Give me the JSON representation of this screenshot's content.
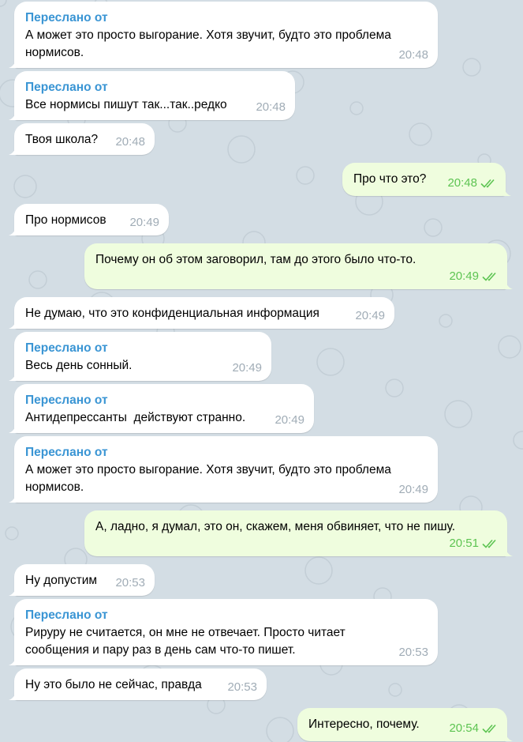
{
  "colors": {
    "background": "#d3dde4",
    "incoming_bubble": "#ffffff",
    "outgoing_bubble": "#effdde",
    "forward_label": "#3a95d4",
    "time_incoming": "#a0acb6",
    "time_outgoing": "#5dc452"
  },
  "messages": [
    {
      "dir": "in",
      "forwarded": "Переслано от",
      "lines": [
        "А может это просто выгорание. Хотя звучит, будто это проблема",
        "нормисов."
      ],
      "time": "20:48"
    },
    {
      "dir": "in",
      "forwarded": "Переслано от",
      "lines": [
        "Все нормисы пишут так...так..редко"
      ],
      "time": "20:48"
    },
    {
      "dir": "in",
      "lines": [
        "Твоя школа?"
      ],
      "time": "20:48"
    },
    {
      "dir": "out",
      "lines": [
        "Про что это?"
      ],
      "time": "20:48",
      "status_icon": "double-check-icon"
    },
    {
      "dir": "in",
      "lines": [
        "Про нормисов"
      ],
      "time": "20:49"
    },
    {
      "dir": "out",
      "lines": [
        "Почему он об этом заговорил, там до этого было что-то."
      ],
      "time": "20:49",
      "status_icon": "double-check-icon"
    },
    {
      "dir": "in",
      "lines": [
        "Не думаю, что это конфиденциальная информация"
      ],
      "time": "20:49"
    },
    {
      "dir": "in",
      "forwarded": "Переслано от",
      "lines": [
        "Весь день сонный."
      ],
      "time": "20:49"
    },
    {
      "dir": "in",
      "forwarded": "Переслано от",
      "lines": [
        "Антидепрессанты  действуют странно."
      ],
      "time": "20:49"
    },
    {
      "dir": "in",
      "forwarded": "Переслано от",
      "lines": [
        "А может это просто выгорание. Хотя звучит, будто это проблема",
        "нормисов."
      ],
      "time": "20:49"
    },
    {
      "dir": "out",
      "lines": [
        "А, ладно, я думал, это он, скажем, меня обвиняет, что не пишу."
      ],
      "time": "20:51",
      "status_icon": "double-check-icon"
    },
    {
      "dir": "in",
      "lines": [
        "Ну допустим"
      ],
      "time": "20:53"
    },
    {
      "dir": "in",
      "forwarded": "Переслано от",
      "lines": [
        "Рирурy не считается, он мне не отвечает. Просто читает",
        "сообщения и пару раз в день сам что-то пишет."
      ],
      "time": "20:53"
    },
    {
      "dir": "in",
      "lines": [
        "Ну это было не сейчас, правда"
      ],
      "time": "20:53"
    },
    {
      "dir": "out",
      "lines": [
        "Интересно, почему."
      ],
      "time": "20:54",
      "status_icon": "double-check-icon"
    }
  ]
}
